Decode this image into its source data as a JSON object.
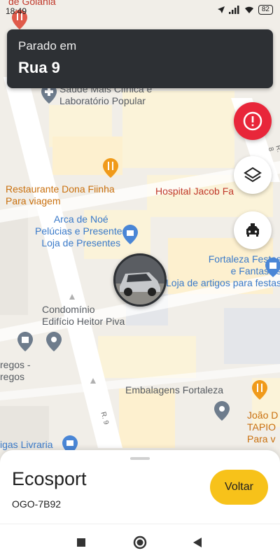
{
  "status_bar": {
    "time": "18:49",
    "battery": "82"
  },
  "banner": {
    "subtitle": "Parado em",
    "title": "Rua 9"
  },
  "map": {
    "places": {
      "goiania": "de Goiânia",
      "saude": "Saúde Mais Clínica e",
      "saude_line2": "Laboratório Popular",
      "restaurante": "Restaurante Dona Fiinha",
      "restaurante_sub": "Para viagem",
      "hospital": "Hospital Jacob Fa",
      "arca": "Arca de Noé",
      "arca_line2": "Pelúcias e Presentes",
      "arca_sub": "Loja de Presentes",
      "fortaleza_festas": "Fortaleza Festas",
      "fortaleza_festas_line2": "e Fantasias",
      "fortaleza_festas_sub": "Loja de artigos para festas",
      "condominio": "Condomínio",
      "condominio_line2": "Edifício Heitor Piva",
      "regos": "regos -",
      "regos_line2": "regos",
      "embalagens": "Embalagens Fortaleza",
      "joao": "João D",
      "joao_line2": "TAPIO",
      "joao_sub": "Para v",
      "livraria": "igas Livraria"
    },
    "streets": {
      "r9": "R. 9",
      "r8": "R. 8"
    }
  },
  "buttons": {
    "alert_icon": "alert-icon",
    "layers_icon": "layers-icon",
    "taxi_icon": "taxi-icon"
  },
  "vehicle": {
    "name": "Ecosport",
    "plate": "OGO-7B92",
    "back_label": "Voltar"
  },
  "colors": {
    "banner_bg": "#2d3034",
    "alert_red": "#e8263a",
    "accent_yellow": "#f7c21a"
  }
}
